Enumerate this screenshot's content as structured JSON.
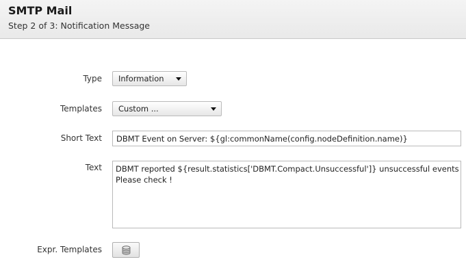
{
  "header": {
    "title": "SMTP Mail",
    "subtitle": "Step 2 of 3: Notification Message"
  },
  "form": {
    "type": {
      "label": "Type",
      "value": "Information"
    },
    "templates": {
      "label": "Templates",
      "value": "Custom ..."
    },
    "short_text": {
      "label": "Short Text",
      "value": "DBMT Event on Server: ${gl:commonName(config.nodeDefinition.name)}"
    },
    "text": {
      "label": "Text",
      "lines": [
        "DBMT reported  ${result.statistics['DBMT.Compact.Unsuccessful']} unsuccessful events",
        "Please check !"
      ]
    },
    "expr_templates": {
      "label": "Expr. Templates",
      "icon": "database-icon"
    }
  }
}
